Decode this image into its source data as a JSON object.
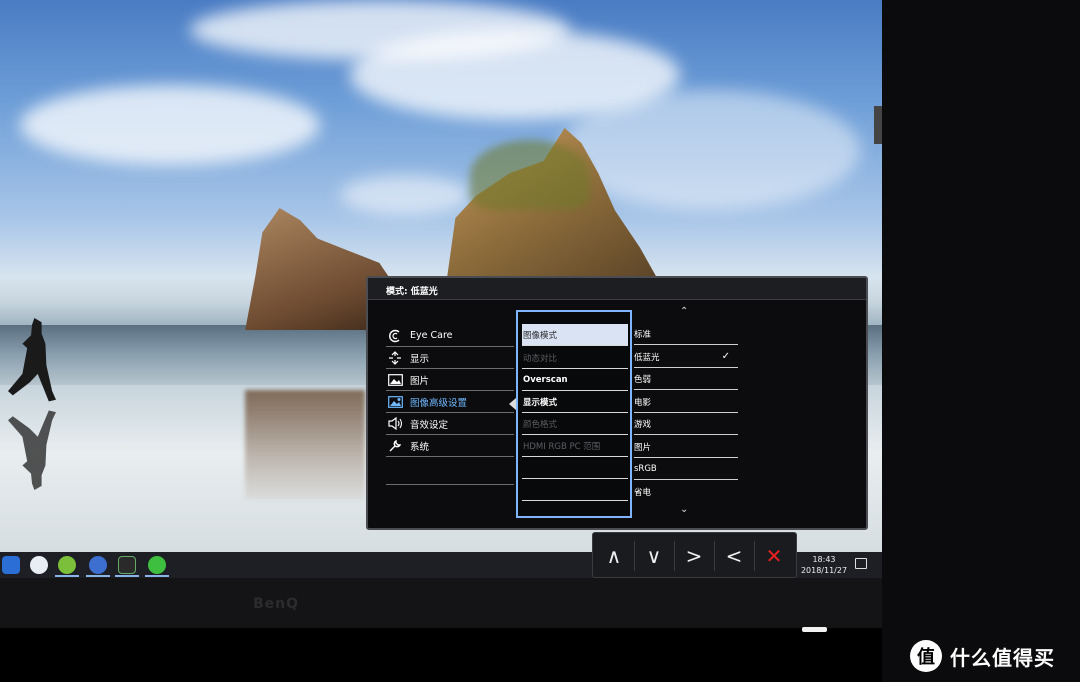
{
  "osd": {
    "title": "模式: 低蓝光",
    "left_menu": [
      {
        "label": "Eye Care",
        "icon": "eye-care-icon"
      },
      {
        "label": "显示",
        "icon": "display-icon"
      },
      {
        "label": "图片",
        "icon": "picture-icon"
      },
      {
        "label": "图像高级设置",
        "icon": "picture-advanced-icon",
        "active": true
      },
      {
        "label": "音效设定",
        "icon": "speaker-icon"
      },
      {
        "label": "系统",
        "icon": "wrench-icon"
      }
    ],
    "middle_menu": [
      {
        "label": "图像模式",
        "state": "selected"
      },
      {
        "label": "动态对比",
        "state": "disabled"
      },
      {
        "label": "Overscan",
        "state": "enabled"
      },
      {
        "label": "显示模式",
        "state": "enabled"
      },
      {
        "label": "颜色格式",
        "state": "disabled"
      },
      {
        "label": "HDMI RGB PC 范围",
        "state": "disabled"
      },
      {
        "label": "",
        "state": "empty"
      },
      {
        "label": "",
        "state": "empty"
      }
    ],
    "right_menu": [
      {
        "label": "标准",
        "checked": false
      },
      {
        "label": "低蓝光",
        "checked": true
      },
      {
        "label": "色弱",
        "checked": false
      },
      {
        "label": "电影",
        "checked": false
      },
      {
        "label": "游戏",
        "checked": false
      },
      {
        "label": "图片",
        "checked": false
      },
      {
        "label": "sRGB",
        "checked": false
      },
      {
        "label": "省电",
        "checked": false
      }
    ],
    "check_mark": "✓",
    "scroll_up": "⌃",
    "scroll_down": "⌄"
  },
  "controls": {
    "up": "∧",
    "down": "∨",
    "right": ">",
    "left": "<",
    "close": "✕"
  },
  "taskbar": {
    "time": "18:43",
    "date": "2018/11/27"
  },
  "bezel": {
    "brand": "BenQ"
  },
  "watermark": {
    "logo_char": "值",
    "text": "什么值得买"
  },
  "colors": {
    "osd_accent": "#6fb8ff",
    "close_red": "#e82020",
    "selected_bg": "#d9e3f3"
  }
}
